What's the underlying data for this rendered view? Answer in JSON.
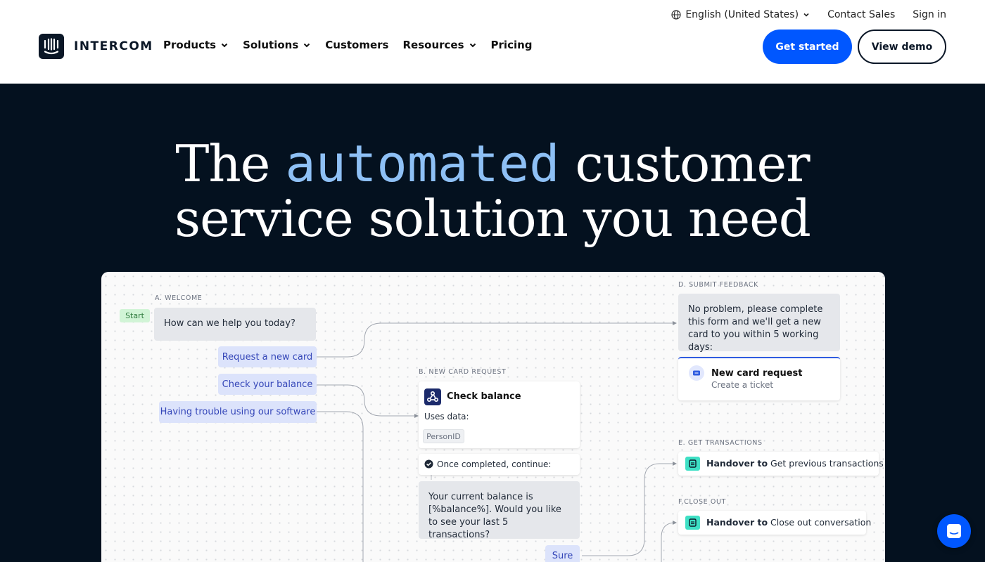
{
  "header": {
    "language": "English (United States)",
    "contact_sales": "Contact Sales",
    "sign_in": "Sign in",
    "brand": "INTERCOM",
    "nav": [
      {
        "label": "Products",
        "dropdown": true
      },
      {
        "label": "Solutions",
        "dropdown": true
      },
      {
        "label": "Customers",
        "dropdown": false
      },
      {
        "label": "Resources",
        "dropdown": true
      },
      {
        "label": "Pricing",
        "dropdown": false
      }
    ],
    "get_started": "Get started",
    "view_demo": "View demo"
  },
  "hero": {
    "headline_pre": "The",
    "headline_accent": "automated",
    "headline_post": "customer",
    "headline_line2": "service solution you need"
  },
  "workflow": {
    "welcome_label": "A. WELCOME",
    "start": "Start",
    "welcome_message": "How can we help you today?",
    "option_new_card": "Request a new card",
    "option_balance": "Check your balance",
    "option_trouble": "Having trouble using our software",
    "new_card_label": "B. NEW CARD REQUEST",
    "check_balance_title": "Check balance",
    "uses_data": "Uses data:",
    "person_id": "PersonID",
    "once_completed": "Once completed, continue:",
    "balance_message": "Your current balance is [%balance%]. Would you like to see your last 5 transactions?",
    "sure": "Sure",
    "feedback_label": "D. SUBMIT FEEDBACK",
    "feedback_message": "No problem, please complete this form and we'll get a new card to you within 5 working days:",
    "ticket_title": "New card request",
    "ticket_subtitle": "Create a ticket",
    "transactions_label": "E. GET TRANSACTIONS",
    "handover_bold": "Handover to",
    "handover_transactions": "Get previous transactions",
    "closeout_label": "F.CLOSE OUT",
    "handover_close": "Close out conversation"
  },
  "colors": {
    "brand_blue": "#0057ff",
    "hero_bg": "#04111f",
    "accent_text": "#8ec0f5"
  },
  "icons": [
    "globe-icon",
    "chevron-down-icon",
    "intercom-logo-icon",
    "webhook-icon",
    "check-circle-icon",
    "ticket-icon",
    "handover-icon",
    "messenger-icon"
  ]
}
